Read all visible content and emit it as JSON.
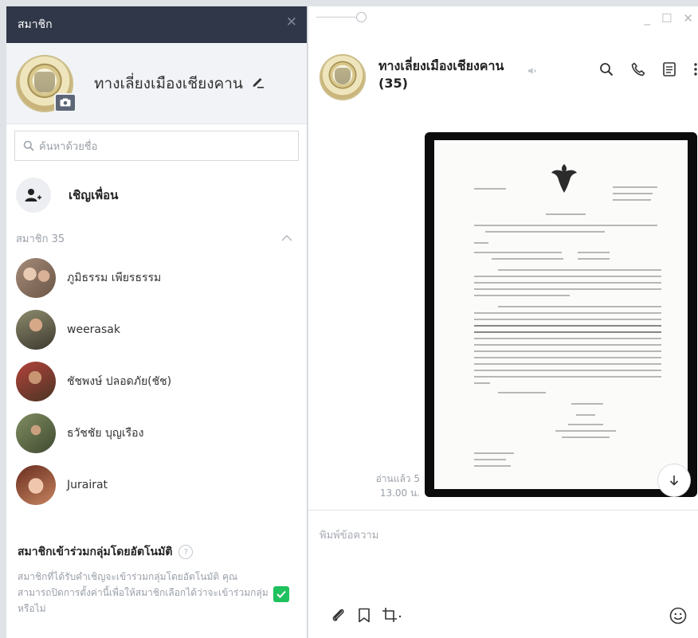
{
  "members_panel": {
    "title": "สมาชิก",
    "group_name": "ทางเลี่ยงเมืองเชียงคาน",
    "search_placeholder": "ค้นหาด้วยชื่อ",
    "invite_label": "เชิญเพื่อน",
    "members_header": "สมาชิก 35",
    "members": [
      {
        "name": "ภูมิธรรม เพียรธรรม",
        "avatar_color": "#8a6e5d"
      },
      {
        "name": "weerasak",
        "avatar_color": "#5e5847"
      },
      {
        "name": "ชัชพงษ์ ปลอดภัย(ชัช)",
        "avatar_color": "#7b5a3c"
      },
      {
        "name": "ธวัชชัย บุญเรือง",
        "avatar_color": "#5f6a4d"
      },
      {
        "name": "Jurairat",
        "avatar_color": "#9a5a3f"
      }
    ],
    "auto_join": {
      "title": "สมาชิกเข้าร่วมกลุ่มโดยอัตโนมัติ",
      "description": "สมาชิกที่ได้รับคำเชิญจะเข้าร่วมกลุ่มโดยอัตโนมัติ คุณสามารถปิดการตั้งค่านี้เพื่อให้สมาชิกเลือกได้ว่าจะเข้าร่วมกลุ่มหรือไม่",
      "checked": true
    }
  },
  "chat_panel": {
    "title": "ทางเลี่ยงเมืองเชียงคาน (35)",
    "read_status": "อ่านแล้ว 5",
    "time": "13.00 น.",
    "input_placeholder": "พิมพ์ข้อความ"
  },
  "colors": {
    "header_dark": "#2f3748",
    "accent_green": "#1fc15e"
  }
}
